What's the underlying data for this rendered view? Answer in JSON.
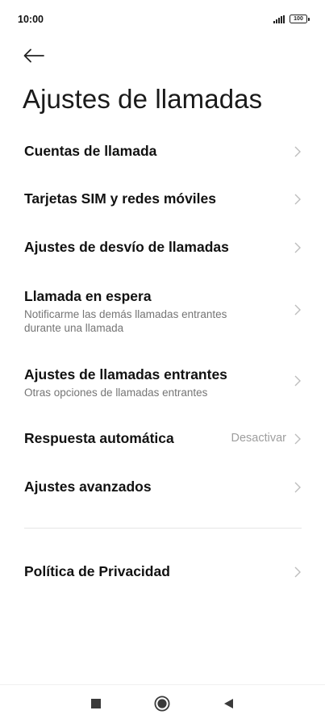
{
  "status_bar": {
    "time": "10:00",
    "battery_level": "100",
    "icons": [
      "signal-icon",
      "battery-icon"
    ]
  },
  "header": {
    "back_icon": "arrow-left-icon",
    "title": "Ajustes de llamadas"
  },
  "items": [
    {
      "title": "Cuentas de llamada",
      "subtitle": "",
      "value": ""
    },
    {
      "title": "Tarjetas SIM y redes móviles",
      "subtitle": "",
      "value": ""
    },
    {
      "title": "Ajustes de desvío de llamadas",
      "subtitle": "",
      "value": ""
    },
    {
      "title": "Llamada en espera",
      "subtitle": "Notificarme las demás llamadas entrantes durante una llamada",
      "value": ""
    },
    {
      "title": "Ajustes de llamadas entrantes",
      "subtitle": "Otras opciones de llamadas entrantes",
      "value": ""
    },
    {
      "title": "Respuesta automática",
      "subtitle": "",
      "value": "Desactivar"
    },
    {
      "title": "Ajustes avanzados",
      "subtitle": "",
      "value": ""
    },
    {
      "title": "Política de Privacidad",
      "subtitle": "",
      "value": ""
    }
  ],
  "nav_bar": {
    "icons": [
      "recents-square-icon",
      "home-circle-icon",
      "back-triangle-icon"
    ]
  },
  "colors": {
    "background": "#ffffff",
    "title_text": "#111111",
    "subtitle_text": "#757575",
    "value_text": "#9e9e9e",
    "chevron": "#bdbdbd"
  }
}
